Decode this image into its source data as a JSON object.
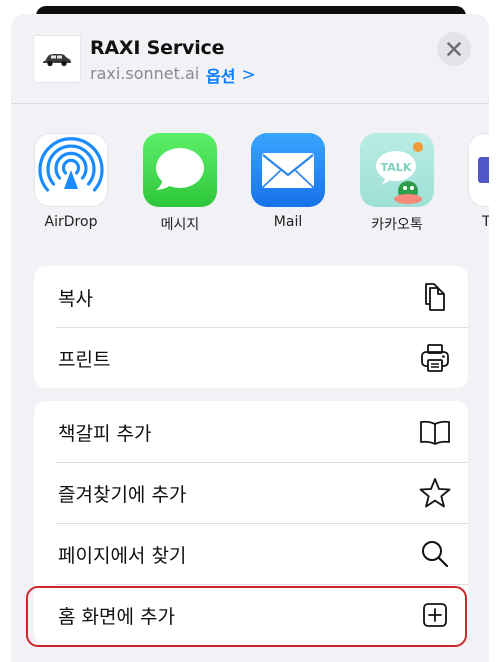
{
  "header": {
    "title": "RAXI Service",
    "url": "raxi.sonnet.ai",
    "options_label": "옵션",
    "options_chevron": ">"
  },
  "apps": [
    {
      "label": "AirDrop",
      "icon": "airdrop-icon"
    },
    {
      "label": "메시지",
      "icon": "messages-icon"
    },
    {
      "label": "Mail",
      "icon": "mail-icon"
    },
    {
      "label": "카카오톡",
      "icon": "kakaotalk-icon"
    },
    {
      "label": "Te",
      "icon": "teams-icon"
    }
  ],
  "kakao_badge": "TALK",
  "actions_group1": [
    {
      "label": "복사",
      "icon": "copy-icon"
    },
    {
      "label": "프린트",
      "icon": "print-icon"
    }
  ],
  "actions_group2": [
    {
      "label": "책갈피 추가",
      "icon": "bookmark-book-icon"
    },
    {
      "label": "즐겨찾기에 추가",
      "icon": "star-icon"
    },
    {
      "label": "페이지에서 찾기",
      "icon": "search-icon"
    },
    {
      "label": "홈 화면에 추가",
      "icon": "add-square-icon"
    }
  ],
  "colors": {
    "accent": "#0a7cff",
    "highlight": "#d0242b",
    "sheet": "#f2f2f6"
  }
}
